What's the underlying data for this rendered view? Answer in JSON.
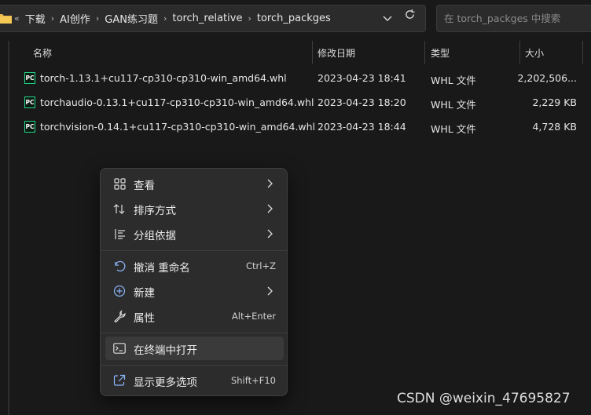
{
  "address_bar": {
    "overflow": "«",
    "crumbs": [
      "下载",
      "AI创作",
      "GAN练习题",
      "torch_relative",
      "torch_packges"
    ]
  },
  "search": {
    "placeholder": "在 torch_packges 中搜索"
  },
  "columns": {
    "name": "名称",
    "modified": "修改日期",
    "type": "类型",
    "size": "大小"
  },
  "files": [
    {
      "icon": "pc",
      "name": "torch-1.13.1+cu117-cp310-cp310-win_amd64.whl",
      "modified": "2023-04-23 18:41",
      "type": "WHL 文件",
      "size": "2,202,506..."
    },
    {
      "icon": "pc",
      "name": "torchaudio-0.13.1+cu117-cp310-cp310-win_amd64.whl",
      "modified": "2023-04-23 18:20",
      "type": "WHL 文件",
      "size": "2,229 KB"
    },
    {
      "icon": "pc",
      "name": "torchvision-0.14.1+cu117-cp310-cp310-win_amd64.whl",
      "modified": "2023-04-23 18:44",
      "type": "WHL 文件",
      "size": "4,728 KB"
    }
  ],
  "context_menu": {
    "items": [
      {
        "label": "查看",
        "icon": "grid-icon",
        "submenu": true
      },
      {
        "label": "排序方式",
        "icon": "sort-icon",
        "submenu": true
      },
      {
        "label": "分组依据",
        "icon": "group-icon",
        "submenu": true
      },
      {
        "label": "撤消 重命名",
        "icon": "undo-icon",
        "shortcut": "Ctrl+Z"
      },
      {
        "label": "新建",
        "icon": "plus-circle-icon",
        "submenu": true
      },
      {
        "label": "属性",
        "icon": "wrench-icon",
        "shortcut": "Alt+Enter"
      },
      {
        "label": "在终端中打开",
        "icon": "terminal-icon",
        "highlighted": true
      },
      {
        "label": "显示更多选项",
        "icon": "share-icon",
        "shortcut": "Shift+F10"
      }
    ]
  },
  "watermark": "CSDN @weixin_47695827",
  "colors": {
    "background": "#191919",
    "menu": "#2c2c2c",
    "pycharm_accent": "#21d789"
  }
}
